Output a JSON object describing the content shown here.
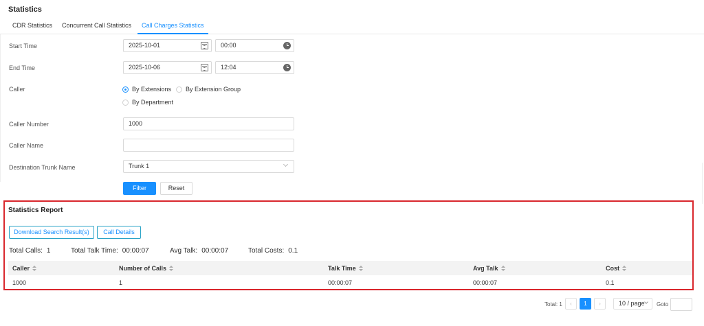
{
  "page": {
    "title": "Statistics"
  },
  "tabs": [
    {
      "label": "CDR Statistics",
      "active": false
    },
    {
      "label": "Concurrent Call Statistics",
      "active": false
    },
    {
      "label": "Call Charges Statistics",
      "active": true
    }
  ],
  "form": {
    "start_time": {
      "label": "Start Time",
      "date": "2025-10-01",
      "time": "00:00"
    },
    "end_time": {
      "label": "End Time",
      "date": "2025-10-06",
      "time": "12:04"
    },
    "caller": {
      "label": "Caller",
      "options": [
        "By Extensions",
        "By Extension Group",
        "By Department"
      ],
      "selected": "By Extensions"
    },
    "caller_number": {
      "label": "Caller Number",
      "value": "1000"
    },
    "caller_name": {
      "label": "Caller Name",
      "value": ""
    },
    "destination_trunk": {
      "label": "Destination Trunk Name",
      "value": "Trunk 1"
    },
    "filter_label": "Filter",
    "reset_label": "Reset"
  },
  "report": {
    "title": "Statistics Report",
    "download_label": "Download Search Result(s)",
    "details_label": "Call Details",
    "summary": {
      "total_calls_label": "Total Calls:",
      "total_calls": "1",
      "total_talk_label": "Total Talk Time:",
      "total_talk": "00:00:07",
      "avg_talk_label": "Avg Talk:",
      "avg_talk": "00:00:07",
      "total_costs_label": "Total Costs:",
      "total_costs": "0.1"
    },
    "columns": [
      "Caller",
      "Number of Calls",
      "Talk Time",
      "Avg Talk",
      "Cost"
    ],
    "rows": [
      [
        "1000",
        "1",
        "00:00:07",
        "00:00:07",
        "0.1"
      ]
    ]
  },
  "pagination": {
    "total_label": "Total: 1",
    "current_page": "1",
    "prev": "‹",
    "next": "›",
    "page_size": "10 / page",
    "goto_label": "Goto"
  },
  "colors": {
    "accent": "#1890ff",
    "highlight_border": "#d9262c"
  }
}
